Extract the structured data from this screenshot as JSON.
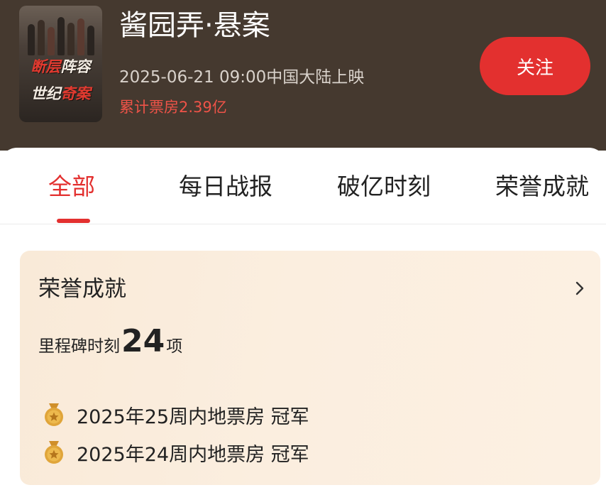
{
  "movie": {
    "title": "酱园弄·悬案",
    "release": "2025-06-21 09:00中国大陆上映",
    "box_office": "累计票房2.39亿",
    "poster_tagline_line1": [
      "断层",
      "阵容"
    ],
    "poster_tagline_line2": [
      "世纪",
      "奇案"
    ]
  },
  "follow_button": {
    "label": "关注"
  },
  "tabs": [
    {
      "label": "全部",
      "active": true
    },
    {
      "label": "每日战报",
      "active": false
    },
    {
      "label": "破亿时刻",
      "active": false
    },
    {
      "label": "荣誉成就",
      "active": false
    }
  ],
  "honor": {
    "title": "荣誉成就",
    "milestone_label": "里程碑时刻",
    "milestone_count": "24",
    "milestone_unit": "项",
    "awards": [
      {
        "text": "2025年25周内地票房 冠军",
        "icon": "gold-medal-icon"
      },
      {
        "text": "2025年24周内地票房 冠军",
        "icon": "gold-medal-icon"
      }
    ]
  },
  "colors": {
    "header_bg": "#45392f",
    "accent_red": "#e3302f",
    "box_office_red": "#ef5348",
    "card_bg": "#fbeedf",
    "medal_gold": "#e0a53a"
  }
}
